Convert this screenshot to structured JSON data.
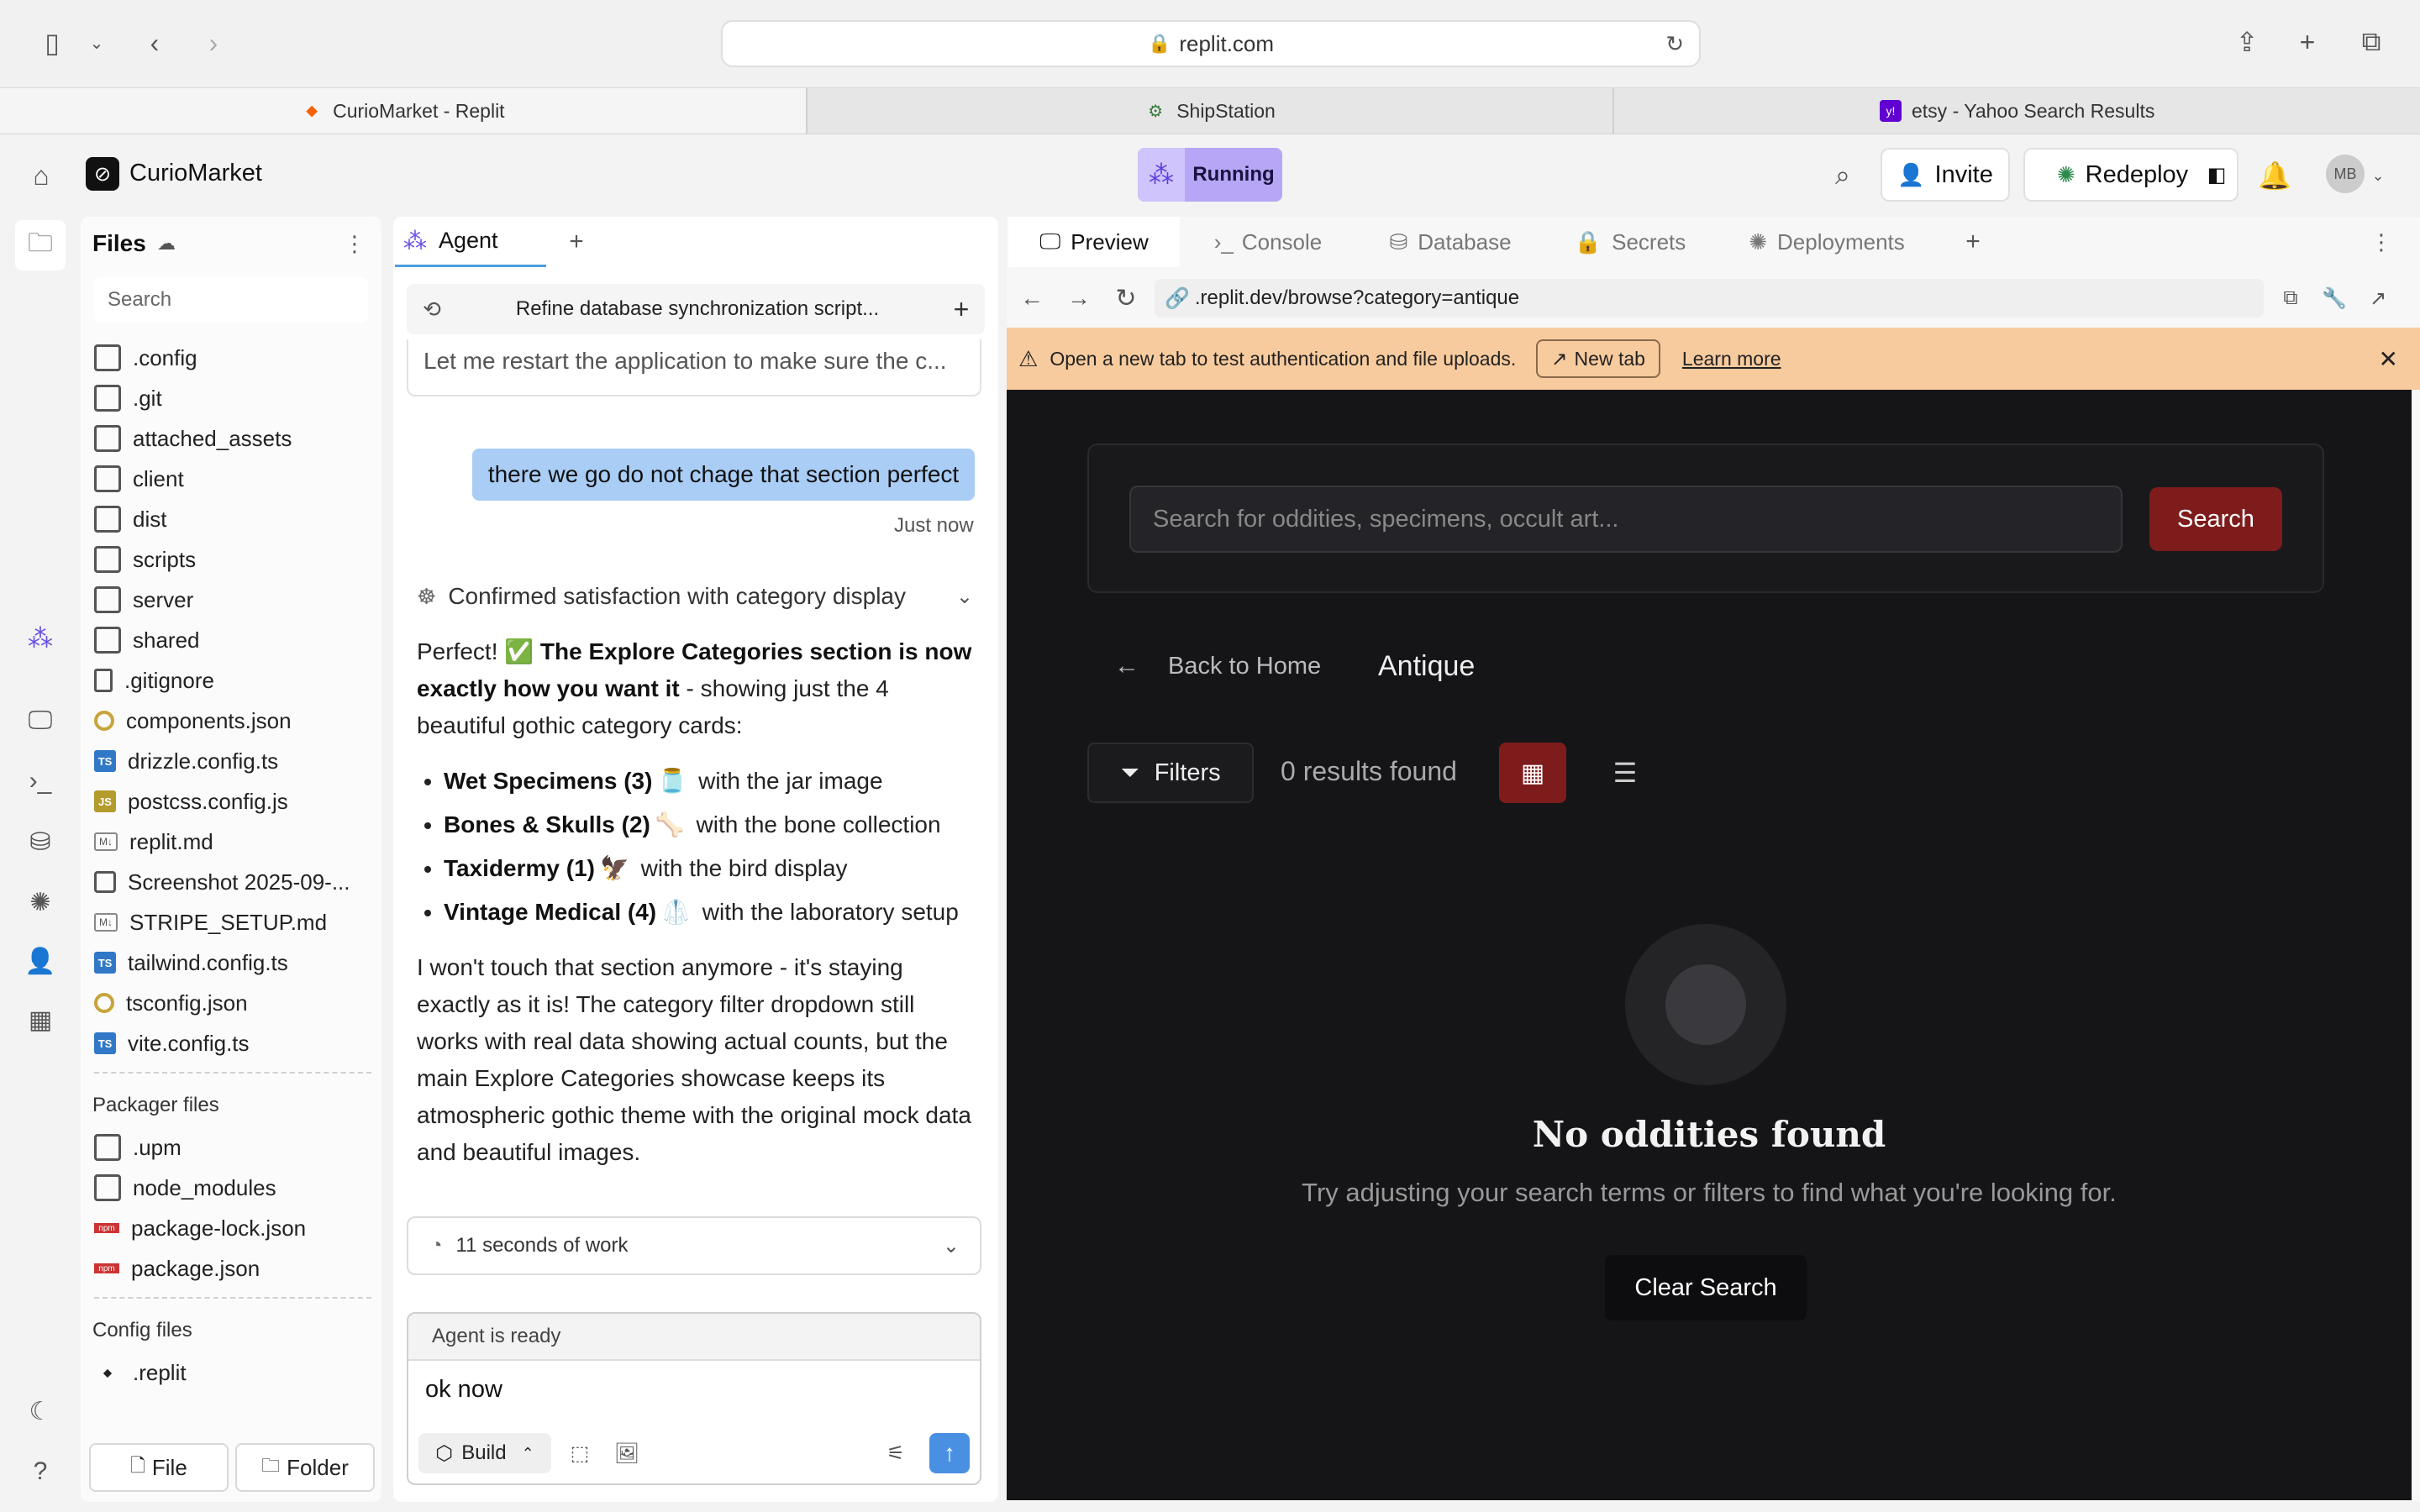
{
  "browser": {
    "address": "replit.com",
    "tabs": [
      {
        "label": "CurioMarket - Replit",
        "active": true
      },
      {
        "label": "ShipStation",
        "active": false
      },
      {
        "label": "etsy - Yahoo Search Results",
        "active": false
      }
    ]
  },
  "header": {
    "app_name": "CurioMarket",
    "status": "Running",
    "invite_label": "Invite",
    "redeploy_label": "Redeploy",
    "avatar_initials": "MB"
  },
  "files": {
    "title": "Files",
    "search_placeholder": "Search",
    "items": [
      {
        "name": ".config",
        "icon": "folder"
      },
      {
        "name": ".git",
        "icon": "folder"
      },
      {
        "name": "attached_assets",
        "icon": "folder"
      },
      {
        "name": "client",
        "icon": "folder"
      },
      {
        "name": "dist",
        "icon": "folder"
      },
      {
        "name": "scripts",
        "icon": "folder"
      },
      {
        "name": "server",
        "icon": "folder"
      },
      {
        "name": "shared",
        "icon": "folder"
      },
      {
        "name": ".gitignore",
        "icon": "doc"
      },
      {
        "name": "components.json",
        "icon": "json"
      },
      {
        "name": "drizzle.config.ts",
        "icon": "ts"
      },
      {
        "name": "postcss.config.js",
        "icon": "js"
      },
      {
        "name": "replit.md",
        "icon": "md"
      },
      {
        "name": "Screenshot 2025-09-...",
        "icon": "image"
      },
      {
        "name": "STRIPE_SETUP.md",
        "icon": "md"
      },
      {
        "name": "tailwind.config.ts",
        "icon": "ts"
      },
      {
        "name": "tsconfig.json",
        "icon": "json"
      },
      {
        "name": "vite.config.ts",
        "icon": "ts"
      }
    ],
    "packager_label": "Packager files",
    "packager_items": [
      {
        "name": ".upm",
        "icon": "folder"
      },
      {
        "name": "node_modules",
        "icon": "folder"
      },
      {
        "name": "package-lock.json",
        "icon": "npm"
      },
      {
        "name": "package.json",
        "icon": "npm"
      }
    ],
    "config_label": "Config files",
    "config_items": [
      {
        "name": ".replit",
        "icon": "replit"
      }
    ],
    "file_button": "File",
    "folder_button": "Folder"
  },
  "agent": {
    "tab_label": "Agent",
    "thread_title": "Refine database synchronization script...",
    "prev_message": "Let me restart the application to make sure the c...",
    "user_message": "there we go do not chage that section perfect",
    "user_time": "Just now",
    "confirm_label": "Confirmed satisfaction with category display",
    "reply_intro_1": "Perfect! ",
    "reply_bold": "The Explore Categories section is now exactly how you want it",
    "reply_intro_2": " - showing just the 4 beautiful gothic category cards:",
    "bullets": [
      {
        "bold": "Wet Specimens (3)",
        "emoji": "🫙",
        "text": " with the jar image"
      },
      {
        "bold": "Bones & Skulls (2)",
        "emoji": "🦴",
        "text": " with the bone collection"
      },
      {
        "bold": "Taxidermy (1)",
        "emoji": "🦅",
        "text": " with the bird display"
      },
      {
        "bold": "Vintage Medical (4)",
        "emoji": "🥼",
        "text": " with the laboratory setup"
      }
    ],
    "reply_outro": "I won't touch that section anymore - it's staying exactly as it is! The category filter dropdown still works with real data showing actual counts, but the main Explore Categories showcase keeps its atmospheric gothic theme with the original mock data and beautiful images.",
    "work_label": "11 seconds of work",
    "input_status": "Agent is ready",
    "input_value": "ok now",
    "build_label": "Build"
  },
  "preview": {
    "tabs": [
      "Preview",
      "Console",
      "Database",
      "Secrets",
      "Deployments"
    ],
    "url": ".replit.dev/browse?category=antique",
    "warning": "Open a new tab to test authentication and file uploads.",
    "new_tab_label": "New tab",
    "learn_more": "Learn more",
    "search_placeholder": "Search for oddities, specimens, occult art...",
    "search_button": "Search",
    "back_label": "Back to Home",
    "category": "Antique",
    "filters_label": "Filters",
    "results": "0 results found",
    "empty_title": "No oddities found",
    "empty_sub": "Try adjusting your search terms or filters to find what you're looking for.",
    "clear_label": "Clear Search"
  }
}
